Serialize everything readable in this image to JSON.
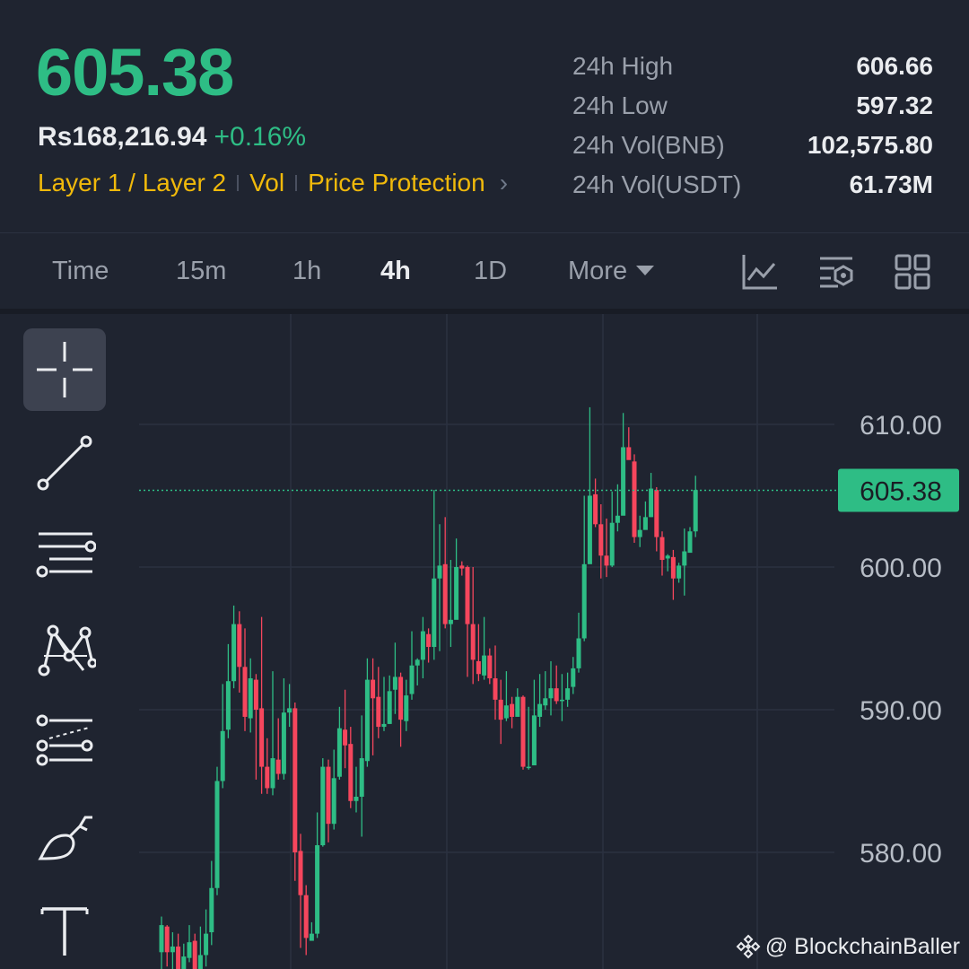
{
  "header": {
    "last_price": "605.38",
    "fiat_price": "Rs168,216.94",
    "change_pct": "+0.16%",
    "tags": [
      "Layer 1 / Layer 2",
      "Vol",
      "Price Protection"
    ],
    "chevron": "›"
  },
  "stats": [
    {
      "label": "24h High",
      "value": "606.66"
    },
    {
      "label": "24h Low",
      "value": "597.32"
    },
    {
      "label": "24h Vol(BNB)",
      "value": "102,575.80"
    },
    {
      "label": "24h Vol(USDT)",
      "value": "61.73M"
    }
  ],
  "timeframes": {
    "items": [
      "Time",
      "15m",
      "1h",
      "4h",
      "1D",
      "More"
    ],
    "active": "4h"
  },
  "toolbar_icons": [
    "indicator-chart-icon",
    "chart-settings-icon",
    "layout-grid-icon"
  ],
  "drawing_tools": [
    "crosshair-icon",
    "trend-line-icon",
    "horizontal-lines-icon",
    "pattern-icon",
    "fib-channel-icon",
    "brush-icon",
    "text-tool-icon"
  ],
  "colors": {
    "up": "#2ebd85",
    "down": "#f6465d",
    "bg": "#1f2430",
    "grid": "#2b3140",
    "accent": "#f0b90b"
  },
  "chart_data": {
    "type": "candlestick",
    "y_ticks": [
      "610.00",
      "600.00",
      "590.00",
      "580.00"
    ],
    "y_tick_values": [
      610,
      600,
      590,
      580
    ],
    "current_price": 605.38,
    "current_price_label": "605.38",
    "candles": [
      [
        573.0,
        574.9,
        570.6,
        575.5
      ],
      [
        574.8,
        573.0,
        572.0,
        574.9
      ],
      [
        573.0,
        573.4,
        571.8,
        574.4
      ],
      [
        573.4,
        571.5,
        571.2,
        574.3
      ],
      [
        571.5,
        572.7,
        571.0,
        573.6
      ],
      [
        572.6,
        573.7,
        572.3,
        574.9
      ],
      [
        573.8,
        571.5,
        571.2,
        574.3
      ],
      [
        571.5,
        572.8,
        571.0,
        574.8
      ],
      [
        572.8,
        574.3,
        572.0,
        576.0
      ],
      [
        574.4,
        577.5,
        573.5,
        579.4
      ],
      [
        577.5,
        585.0,
        577.0,
        586.0
      ],
      [
        585.0,
        588.5,
        584.5,
        591.8
      ],
      [
        588.6,
        592.0,
        588.0,
        594.6
      ],
      [
        592.0,
        596.0,
        591.5,
        597.3
      ],
      [
        596.0,
        593.0,
        591.2,
        596.9
      ],
      [
        593.0,
        589.5,
        588.5,
        595.7
      ],
      [
        589.4,
        592.2,
        588.4,
        593.6
      ],
      [
        592.1,
        590.0,
        585.1,
        592.5
      ],
      [
        590.1,
        586.0,
        584.1,
        596.5
      ],
      [
        586.0,
        584.5,
        584.1,
        588.0
      ],
      [
        584.5,
        586.6,
        584.0,
        592.7
      ],
      [
        586.5,
        585.5,
        585.1,
        589.4
      ],
      [
        585.5,
        589.8,
        585.1,
        592.2
      ],
      [
        589.8,
        590.1,
        588.8,
        591.8
      ],
      [
        590.1,
        580.0,
        578.0,
        590.5
      ],
      [
        580.1,
        577.0,
        573.3,
        581.3
      ],
      [
        577.0,
        574.0,
        572.8,
        577.7
      ],
      [
        573.8,
        574.3,
        574.0,
        575.1
      ],
      [
        574.3,
        580.5,
        574.0,
        582.8
      ],
      [
        580.5,
        586.0,
        580.4,
        586.6
      ],
      [
        586.0,
        582.0,
        580.7,
        586.5
      ],
      [
        582.0,
        585.2,
        581.6,
        587.2
      ],
      [
        585.3,
        588.7,
        585.1,
        590.2
      ],
      [
        588.6,
        587.5,
        585.9,
        591.4
      ],
      [
        587.6,
        583.6,
        583.1,
        588.8
      ],
      [
        583.6,
        583.9,
        582.8,
        586.0
      ],
      [
        583.9,
        586.6,
        581.1,
        589.6
      ],
      [
        586.4,
        592.1,
        586.0,
        593.6
      ],
      [
        592.1,
        590.8,
        586.8,
        593.6
      ],
      [
        590.9,
        588.8,
        588.0,
        593.0
      ],
      [
        588.8,
        589.0,
        588.5,
        592.3
      ],
      [
        589.0,
        591.3,
        589.0,
        592.4
      ],
      [
        591.4,
        592.3,
        589.7,
        594.7
      ],
      [
        592.3,
        589.3,
        587.4,
        592.6
      ],
      [
        589.2,
        591.0,
        588.5,
        592.1
      ],
      [
        591.1,
        593.1,
        590.7,
        595.5
      ],
      [
        593.1,
        593.5,
        591.7,
        593.6
      ],
      [
        593.5,
        595.5,
        592.2,
        596.5
      ],
      [
        595.3,
        594.4,
        593.3,
        595.7
      ],
      [
        594.4,
        599.2,
        593.5,
        605.4
      ],
      [
        599.2,
        600.1,
        594.1,
        603.0
      ],
      [
        600.2,
        596.0,
        595.7,
        603.5
      ],
      [
        596.0,
        596.3,
        594.4,
        600.5
      ],
      [
        596.3,
        600.0,
        597.8,
        602.0
      ],
      [
        600.1,
        599.9,
        599.4,
        600.4
      ],
      [
        600.0,
        596.0,
        592.3,
        600.1
      ],
      [
        596.0,
        593.5,
        591.8,
        600.0
      ],
      [
        593.4,
        592.5,
        592.0,
        596.0
      ],
      [
        592.4,
        593.8,
        592.1,
        596.5
      ],
      [
        593.8,
        592.2,
        591.8,
        594.3
      ],
      [
        592.2,
        590.7,
        589.3,
        594.5
      ],
      [
        590.7,
        589.3,
        587.6,
        592.1
      ],
      [
        589.4,
        590.3,
        589.2,
        592.7
      ],
      [
        590.4,
        589.5,
        588.7,
        590.9
      ],
      [
        589.5,
        590.9,
        590.3,
        591.5
      ],
      [
        590.9,
        586.0,
        585.8,
        591.0
      ],
      [
        586.0,
        586.0,
        585.8,
        590.2
      ],
      [
        586.1,
        589.6,
        589.2,
        592.1
      ],
      [
        589.5,
        590.4,
        588.8,
        592.5
      ],
      [
        590.3,
        590.8,
        590.0,
        592.7
      ],
      [
        590.8,
        591.5,
        589.6,
        593.4
      ],
      [
        591.5,
        590.6,
        590.4,
        593.1
      ],
      [
        590.6,
        590.7,
        589.2,
        592.5
      ],
      [
        590.7,
        591.5,
        590.2,
        592.6
      ],
      [
        591.6,
        592.9,
        591.1,
        593.7
      ],
      [
        592.9,
        595.0,
        592.6,
        596.8
      ],
      [
        595.0,
        600.2,
        594.8,
        605.0
      ],
      [
        600.2,
        605.0,
        604.5,
        611.2
      ],
      [
        605.1,
        603.0,
        602.8,
        606.2
      ],
      [
        603.0,
        600.8,
        599.2,
        604.4
      ],
      [
        600.8,
        600.1,
        599.3,
        603.4
      ],
      [
        600.1,
        603.1,
        600.0,
        605.3
      ],
      [
        603.1,
        603.6,
        602.5,
        605.8
      ],
      [
        603.6,
        608.4,
        606.6,
        610.8
      ],
      [
        608.4,
        607.5,
        607.8,
        609.8
      ],
      [
        607.4,
        602.1,
        601.7,
        607.9
      ],
      [
        602.1,
        602.6,
        601.4,
        603.6
      ],
      [
        602.6,
        603.5,
        602.7,
        604.6
      ],
      [
        603.5,
        605.5,
        603.5,
        606.6
      ],
      [
        605.4,
        602.1,
        601.1,
        605.6
      ],
      [
        602.1,
        600.5,
        599.4,
        602.5
      ],
      [
        600.6,
        600.8,
        599.7,
        600.9
      ],
      [
        600.7,
        599.2,
        597.7,
        601.2
      ],
      [
        599.2,
        600.1,
        598.9,
        600.3
      ],
      [
        600.1,
        601.1,
        598.0,
        602.7
      ],
      [
        601.0,
        602.5,
        602.0,
        602.8
      ],
      [
        602.5,
        605.4,
        602.1,
        606.4
      ]
    ]
  },
  "watermark": "@ BlockchainBaller"
}
